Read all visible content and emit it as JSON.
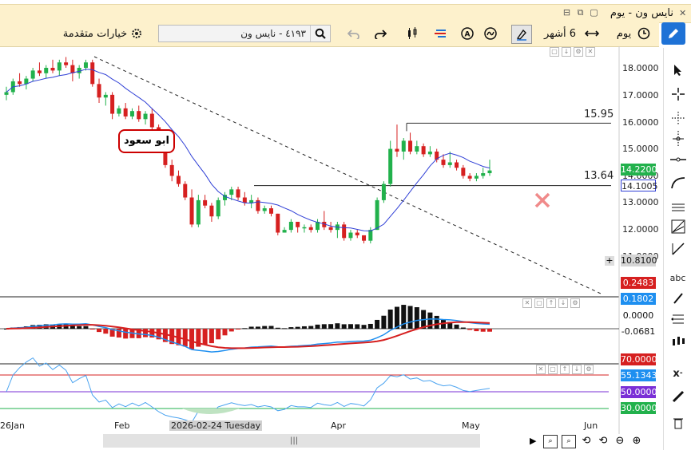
{
  "window": {
    "title": "نايس ون - يوم"
  },
  "toolbar": {
    "advanced_options": "خيارات متقدمة",
    "search_value": "٤١٩٣ - نايس ون",
    "period": "6 أشهر",
    "interval": "يوم"
  },
  "chart": {
    "annotation": "ابو سعود",
    "level_high": "15.95",
    "level_low": "13.64",
    "price_ticks": [
      "18.0000",
      "17.0000",
      "16.0000",
      "15.0000",
      "14.0000",
      "13.0000",
      "12.0000",
      "11.0000"
    ],
    "last_price": "14.2200",
    "ma_value": "14.1005",
    "crosshair_price": "10.8100",
    "macd_vals": [
      "0.2483",
      "0.1802",
      "0.0000",
      "-0.0681"
    ],
    "rsi_vals": [
      "70.0000",
      "55.1343",
      "50.0000",
      "30.0000"
    ],
    "x_labels": [
      "26Jan",
      "Feb",
      "Apr",
      "May",
      "Jun"
    ],
    "crosshair_date": "2026-02-24 Tuesday"
  },
  "colors": {
    "accent": "#1e72d6",
    "bull": "#22b14c",
    "bear": "#d62020",
    "ma": "#2f3fd6",
    "toolbar_bg": "#fdf1cc"
  },
  "chart_data": {
    "type": "candlestick",
    "ylim": [
      10.5,
      18.6
    ],
    "x_labels": [
      "26Jan",
      "Feb",
      "Apr",
      "May",
      "Jun"
    ],
    "candles": [
      [
        17.0,
        17.3,
        16.8,
        17.1
      ],
      [
        17.1,
        17.6,
        17.0,
        17.5
      ],
      [
        17.5,
        17.8,
        17.3,
        17.4
      ],
      [
        17.4,
        17.7,
        17.2,
        17.6
      ],
      [
        17.6,
        18.0,
        17.5,
        17.9
      ],
      [
        17.9,
        18.2,
        17.7,
        17.8
      ],
      [
        17.8,
        18.1,
        17.6,
        18.0
      ],
      [
        18.0,
        18.3,
        17.8,
        17.9
      ],
      [
        17.9,
        18.3,
        17.7,
        18.2
      ],
      [
        18.2,
        18.4,
        18.0,
        18.1
      ],
      [
        18.1,
        18.3,
        17.5,
        17.8
      ],
      [
        17.8,
        18.1,
        17.6,
        18.0
      ],
      [
        18.0,
        18.3,
        17.9,
        18.2
      ],
      [
        18.2,
        18.3,
        17.3,
        17.4
      ],
      [
        17.4,
        17.6,
        16.7,
        16.9
      ],
      [
        16.9,
        17.1,
        16.6,
        17.0
      ],
      [
        17.0,
        17.1,
        16.1,
        16.3
      ],
      [
        16.3,
        16.6,
        16.2,
        16.5
      ],
      [
        16.5,
        16.7,
        16.1,
        16.2
      ],
      [
        16.2,
        16.5,
        16.1,
        16.4
      ],
      [
        16.4,
        16.6,
        16.0,
        16.1
      ],
      [
        16.1,
        16.4,
        15.9,
        16.3
      ],
      [
        16.3,
        16.5,
        15.7,
        15.8
      ],
      [
        15.8,
        15.9,
        15.0,
        15.1
      ],
      [
        15.1,
        15.2,
        14.3,
        14.4
      ],
      [
        14.4,
        14.6,
        13.8,
        14.0
      ],
      [
        14.0,
        14.2,
        13.6,
        13.7
      ],
      [
        13.7,
        13.8,
        13.1,
        13.2
      ],
      [
        13.2,
        13.5,
        12.1,
        12.2
      ],
      [
        12.2,
        13.3,
        12.1,
        13.1
      ],
      [
        13.1,
        13.3,
        12.8,
        12.9
      ],
      [
        12.9,
        13.0,
        12.3,
        12.5
      ],
      [
        12.5,
        13.2,
        12.4,
        13.1
      ],
      [
        13.1,
        13.4,
        12.9,
        13.3
      ],
      [
        13.3,
        13.6,
        13.1,
        13.5
      ],
      [
        13.5,
        13.6,
        13.1,
        13.2
      ],
      [
        13.2,
        13.4,
        12.9,
        13.0
      ],
      [
        13.0,
        13.3,
        12.8,
        13.1
      ],
      [
        13.1,
        13.2,
        12.6,
        12.7
      ],
      [
        12.7,
        12.9,
        12.6,
        12.8
      ],
      [
        12.8,
        12.9,
        12.5,
        12.6
      ],
      [
        12.6,
        12.6,
        11.8,
        11.9
      ],
      [
        11.9,
        12.1,
        11.9,
        12.0
      ],
      [
        12.0,
        12.4,
        11.9,
        12.3
      ],
      [
        12.3,
        12.3,
        11.9,
        12.1
      ],
      [
        12.1,
        12.2,
        11.9,
        12.1
      ],
      [
        12.1,
        12.2,
        11.9,
        12.0
      ],
      [
        12.0,
        12.4,
        11.9,
        12.3
      ],
      [
        12.3,
        12.7,
        12.0,
        12.1
      ],
      [
        12.1,
        12.3,
        11.9,
        12.0
      ],
      [
        12.0,
        12.3,
        11.7,
        12.2
      ],
      [
        12.2,
        12.3,
        11.6,
        11.7
      ],
      [
        11.7,
        12.0,
        11.6,
        11.9
      ],
      [
        11.9,
        12.0,
        11.7,
        11.8
      ],
      [
        11.8,
        11.8,
        11.5,
        11.6
      ],
      [
        11.6,
        12.1,
        11.5,
        12.0
      ],
      [
        12.0,
        13.2,
        12.0,
        13.1
      ],
      [
        13.1,
        13.8,
        13.0,
        13.7
      ],
      [
        13.7,
        15.3,
        13.6,
        15.0
      ],
      [
        15.0,
        15.9,
        14.7,
        14.9
      ],
      [
        14.9,
        15.4,
        14.6,
        15.3
      ],
      [
        15.3,
        15.6,
        14.8,
        14.9
      ],
      [
        14.9,
        15.3,
        14.8,
        15.1
      ],
      [
        15.1,
        15.2,
        14.7,
        14.8
      ],
      [
        14.8,
        15.1,
        14.7,
        14.9
      ],
      [
        14.9,
        15.0,
        14.5,
        14.6
      ],
      [
        14.6,
        14.8,
        14.3,
        14.4
      ],
      [
        14.4,
        14.9,
        14.3,
        14.5
      ],
      [
        14.5,
        14.6,
        14.2,
        14.3
      ],
      [
        14.3,
        14.4,
        13.9,
        14.0
      ],
      [
        14.0,
        14.1,
        13.8,
        13.9
      ],
      [
        13.9,
        14.1,
        13.8,
        14.0
      ],
      [
        14.0,
        14.3,
        13.9,
        14.1
      ],
      [
        14.1,
        14.6,
        14.0,
        14.2
      ]
    ],
    "levels": [
      15.95,
      13.64
    ]
  }
}
